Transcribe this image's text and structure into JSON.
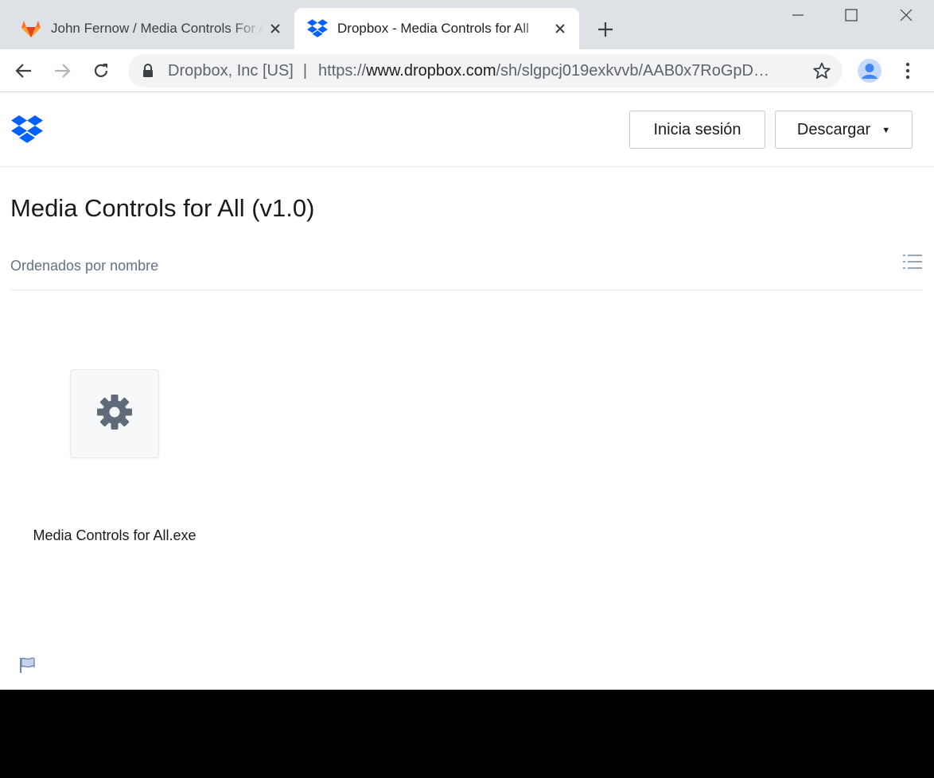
{
  "browser": {
    "tabs": [
      {
        "title": "John Fernow / Media Controls For All",
        "favicon": "gitlab-icon",
        "active": false
      },
      {
        "title": "Dropbox - Media Controls for All",
        "favicon": "dropbox-icon",
        "active": true
      }
    ],
    "address_bar": {
      "organization": "Dropbox, Inc [US]",
      "url_scheme": "https://",
      "url_host": "www.dropbox.com",
      "url_path": "/sh/slgpcj019exkvvb/AAB0x7RoGpD…"
    }
  },
  "header": {
    "login_label": "Inicia sesión",
    "download_label": "Descargar",
    "download_caret": "▼"
  },
  "folder": {
    "title": "Media Controls for All (v1.0)",
    "sort_label": "Ordenados por nombre"
  },
  "files": [
    {
      "name": "Media Controls for All.exe",
      "icon": "gear-icon"
    }
  ],
  "colors": {
    "dropbox_blue": "#0061fe",
    "gitlab_orange": "#e24329",
    "chrome_frame": "#dee1e6"
  }
}
